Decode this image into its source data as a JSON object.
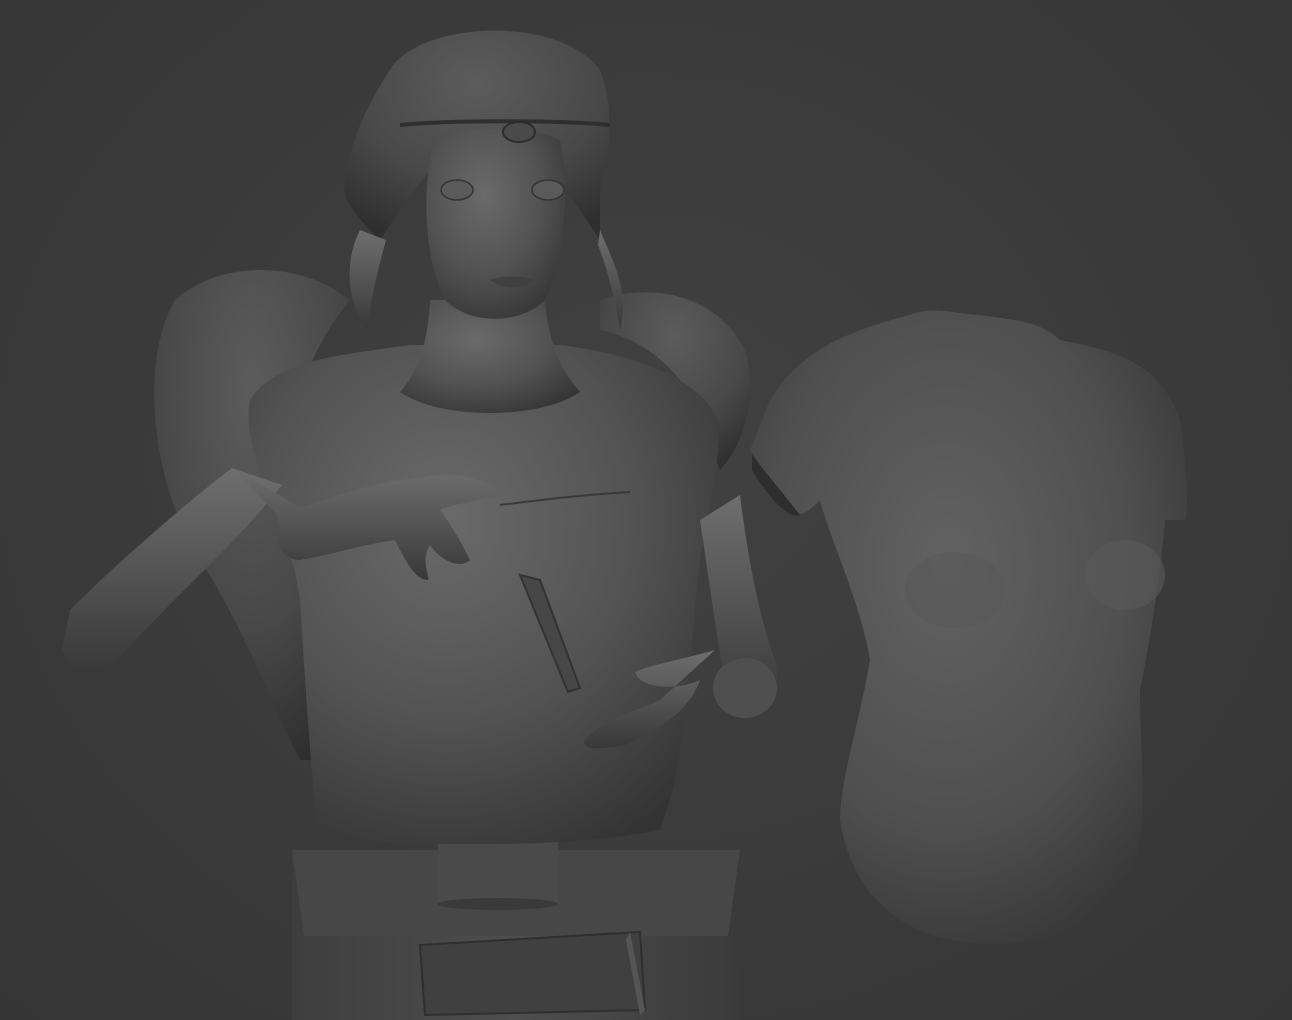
{
  "viewport": {
    "background": "#3c3c3c",
    "mesh_color": "#555555",
    "shading": "clay"
  },
  "scene": {
    "objects": [
      {
        "name": "bust-figure",
        "icon": "sculpt-mesh-icon"
      },
      {
        "name": "display-pedestal",
        "icon": "cube-icon"
      },
      {
        "name": "torso-study",
        "icon": "sculpt-mesh-icon"
      }
    ]
  }
}
